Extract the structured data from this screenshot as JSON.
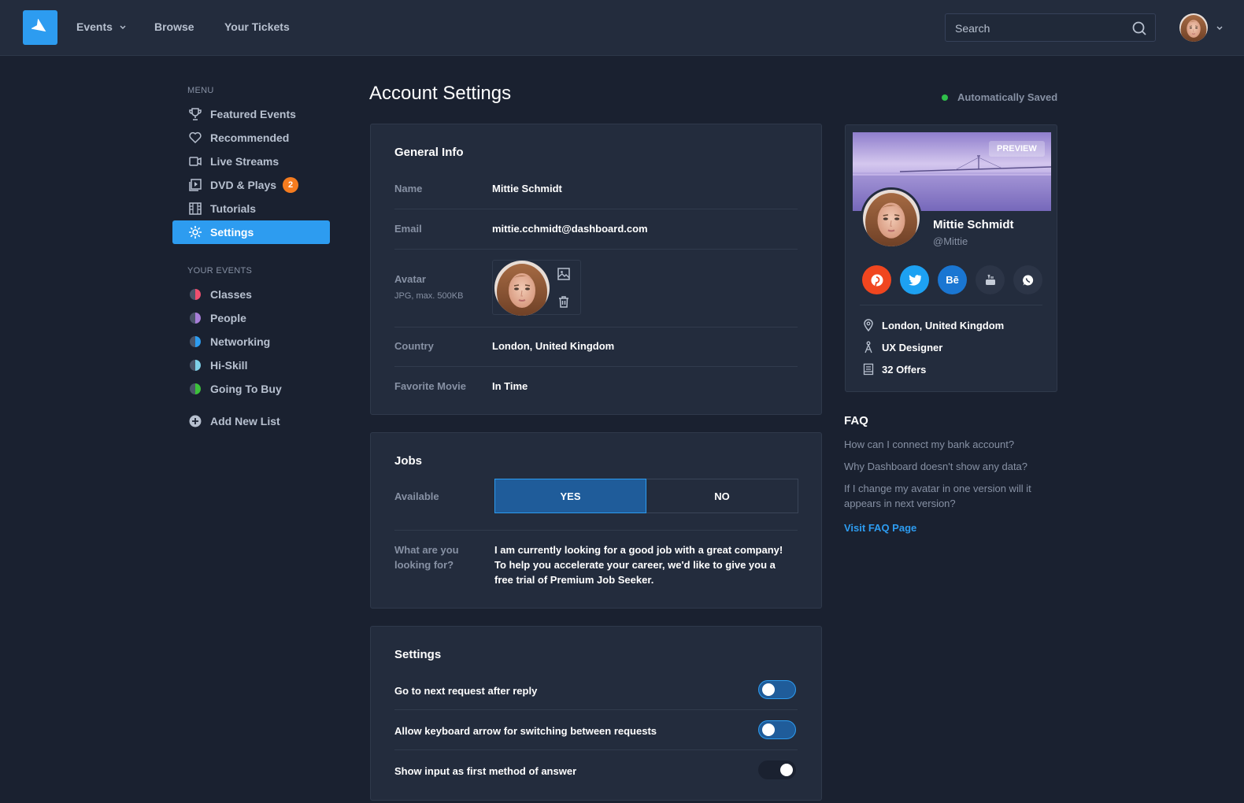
{
  "header": {
    "nav": [
      {
        "label": "Events"
      },
      {
        "label": "Browse"
      },
      {
        "label": "Your Tickets"
      }
    ],
    "search_placeholder": "Search"
  },
  "sidebar": {
    "menu_title": "MENU",
    "menu_items": [
      {
        "label": "Featured Events",
        "icon": "trophy-icon"
      },
      {
        "label": "Recommended",
        "icon": "heart-icon"
      },
      {
        "label": "Live Streams",
        "icon": "video-icon"
      },
      {
        "label": "DVD & Plays",
        "icon": "play-icon",
        "badge": "2"
      },
      {
        "label": "Tutorials",
        "icon": "film-icon"
      },
      {
        "label": "Settings",
        "icon": "gear-icon",
        "active": true
      }
    ],
    "events_title": "YOUR EVENTS",
    "event_items": [
      {
        "label": "Classes",
        "color": "#ef4f6f"
      },
      {
        "label": "People",
        "color": "#a77ed8"
      },
      {
        "label": "Networking",
        "color": "#2d9cf0"
      },
      {
        "label": "Hi-Skill",
        "color": "#7fd0e8"
      },
      {
        "label": "Going To Buy",
        "color": "#3cc13b"
      }
    ],
    "add_list_label": "Add New List"
  },
  "main": {
    "title": "Account Settings",
    "saved_status": "Automatically Saved",
    "general": {
      "title": "General Info",
      "name_label": "Name",
      "name_value": "Mittie Schmidt",
      "email_label": "Email",
      "email_value": "mittie.cchmidt@dashboard.com",
      "avatar_label": "Avatar",
      "avatar_hint": "JPG, max. 500KB",
      "country_label": "Country",
      "country_value": "London, United Kingdom",
      "movie_label": "Favorite Movie",
      "movie_value": "In Time"
    },
    "jobs": {
      "title": "Jobs",
      "available_label": "Available",
      "yes_label": "YES",
      "no_label": "NO",
      "selected": "YES",
      "looking_label_1": "What are you",
      "looking_label_2": "looking for?",
      "looking_line_1": "I am currently looking for a good job with a great company!",
      "looking_line_2": "To help you accelerate your career, we'd like to give you a",
      "looking_line_3": "free trial of Premium Job Seeker."
    },
    "settings": {
      "title": "Settings",
      "toggles": [
        {
          "label": "Go to next request after reply",
          "on": false
        },
        {
          "label": "Allow keyboard arrow for switching between requests",
          "on": false
        },
        {
          "label": "Show input as first method of answer",
          "on": true
        }
      ]
    }
  },
  "profile": {
    "preview_label": "PREVIEW",
    "name": "Mittie Schmidt",
    "handle": "@Mittie",
    "socials": [
      {
        "name": "pinterest-icon",
        "color": "#f0461f"
      },
      {
        "name": "twitter-icon",
        "color": "#1da1f2"
      },
      {
        "name": "behance-icon",
        "color": "#1a76d2",
        "text": "Bē"
      },
      {
        "name": "youtube-icon",
        "color": "#2c3547"
      },
      {
        "name": "whatsapp-icon",
        "color": "#2c3547"
      }
    ],
    "location": "London, United Kingdom",
    "role": "UX Designer",
    "offers": "32 Offers"
  },
  "faq": {
    "title": "FAQ",
    "q1": "How can I connect my bank account?",
    "q2": "Why Dashboard doesn't show any data?",
    "q3_line1": "If I change my avatar in one version will it",
    "q3_line2": "appears in next version?",
    "link": "Visit FAQ Page"
  }
}
